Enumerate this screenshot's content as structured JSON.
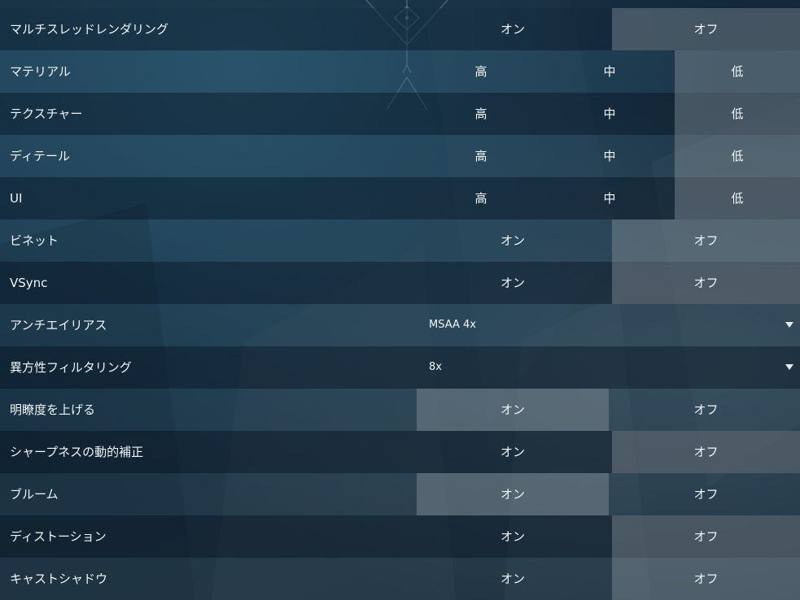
{
  "settings": [
    {
      "label": "マルチスレッドレンダリング",
      "type": "toggle",
      "options": [
        "オン",
        "オフ"
      ],
      "selected": 1
    },
    {
      "label": "マテリアル",
      "type": "quality",
      "options": [
        "高",
        "中",
        "低"
      ],
      "selected": 2
    },
    {
      "label": "テクスチャー",
      "type": "quality",
      "options": [
        "高",
        "中",
        "低"
      ],
      "selected": 2
    },
    {
      "label": "ディテール",
      "type": "quality",
      "options": [
        "高",
        "中",
        "低"
      ],
      "selected": 2
    },
    {
      "label": "UI",
      "type": "quality",
      "options": [
        "高",
        "中",
        "低"
      ],
      "selected": 2
    },
    {
      "label": "ビネット",
      "type": "toggle",
      "options": [
        "オン",
        "オフ"
      ],
      "selected": 1
    },
    {
      "label": "VSync",
      "type": "toggle",
      "options": [
        "オン",
        "オフ"
      ],
      "selected": 1
    },
    {
      "label": "アンチエイリアス",
      "type": "dropdown",
      "value": "MSAA 4x"
    },
    {
      "label": "異方性フィルタリング",
      "type": "dropdown",
      "value": "8x"
    },
    {
      "label": "明瞭度を上げる",
      "type": "toggle",
      "options": [
        "オン",
        "オフ"
      ],
      "selected": 0
    },
    {
      "label": "シャープネスの動的補正",
      "type": "toggle",
      "options": [
        "オン",
        "オフ"
      ],
      "selected": 1
    },
    {
      "label": "ブルーム",
      "type": "toggle",
      "options": [
        "オン",
        "オフ"
      ],
      "selected": 0
    },
    {
      "label": "ディストーション",
      "type": "toggle",
      "options": [
        "オン",
        "オフ"
      ],
      "selected": 1
    },
    {
      "label": "キャストシャドウ",
      "type": "toggle",
      "options": [
        "オン",
        "オフ"
      ],
      "selected": 1
    }
  ],
  "icons": {
    "dropdown": "caret-down-icon",
    "emblem": "emblem-icon"
  },
  "colors": {
    "selected_bg": "#7f8a93",
    "row_dark": "#0c1e2e",
    "row_light": "#28485f",
    "text": "#f0f4f7"
  }
}
